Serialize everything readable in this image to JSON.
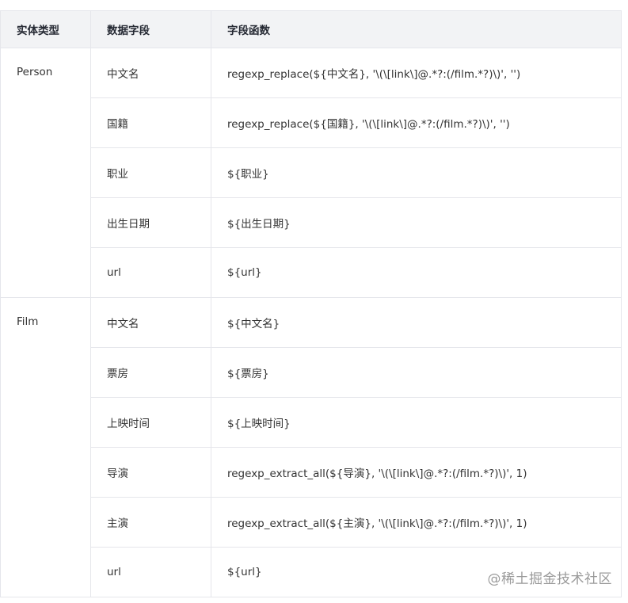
{
  "table": {
    "headers": [
      "实体类型",
      "数据字段",
      "字段函数"
    ],
    "groups": [
      {
        "entity": "Person",
        "rows": [
          {
            "field": "中文名",
            "func": "regexp_replace(${中文名}, '\\(\\[link\\]@.*?:(/film.*?)\\)', '')"
          },
          {
            "field": "国籍",
            "func": "regexp_replace(${国籍}, '\\(\\[link\\]@.*?:(/film.*?)\\)', '')"
          },
          {
            "field": "职业",
            "func": "${职业}"
          },
          {
            "field": "出生日期",
            "func": "${出生日期}"
          },
          {
            "field": "url",
            "func": "${url}"
          }
        ]
      },
      {
        "entity": "Film",
        "rows": [
          {
            "field": "中文名",
            "func": "${中文名}"
          },
          {
            "field": "票房",
            "func": "${票房}"
          },
          {
            "field": "上映时间",
            "func": "${上映时间}"
          },
          {
            "field": "导演",
            "func": "regexp_extract_all(${导演}, '\\(\\[link\\]@.*?:(/film.*?)\\)', 1)"
          },
          {
            "field": "主演",
            "func": "regexp_extract_all(${主演}, '\\(\\[link\\]@.*?:(/film.*?)\\)', 1)"
          },
          {
            "field": "url",
            "func": "${url}"
          }
        ]
      }
    ]
  },
  "watermark": "@稀土掘金技术社区"
}
